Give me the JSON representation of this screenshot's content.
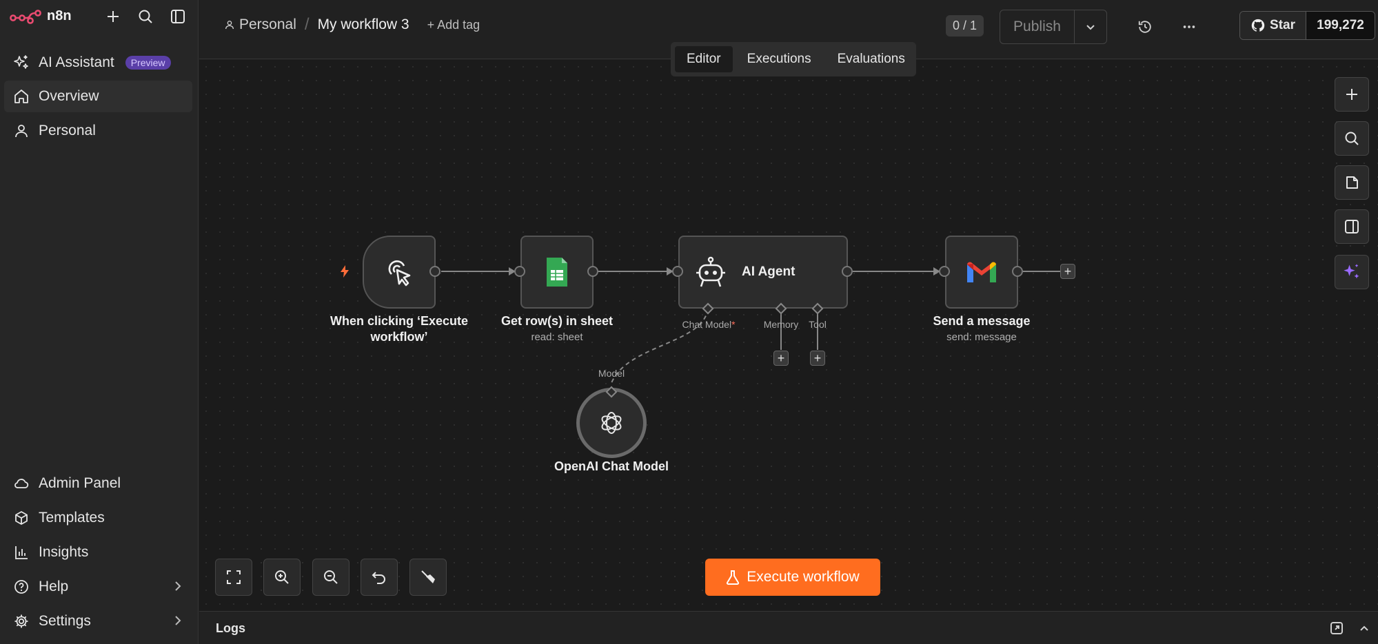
{
  "app": {
    "name": "n8n"
  },
  "sidebar": {
    "top_items": [
      {
        "label": "AI Assistant",
        "badge": "Preview",
        "icon": "sparkles-icon"
      },
      {
        "label": "Overview",
        "icon": "home-icon",
        "active": true
      },
      {
        "label": "Personal",
        "icon": "user-icon"
      }
    ],
    "bottom_items": [
      {
        "label": "Admin Panel",
        "icon": "cloud-icon"
      },
      {
        "label": "Templates",
        "icon": "box-icon"
      },
      {
        "label": "Insights",
        "icon": "bar-chart-icon"
      },
      {
        "label": "Help",
        "icon": "help-icon"
      },
      {
        "label": "Settings",
        "icon": "gear-icon"
      }
    ]
  },
  "header": {
    "project": "Personal",
    "separator": "/",
    "workflow_name": "My workflow 3",
    "add_tag": "+ Add tag",
    "counter": "0 / 1",
    "publish": "Publish",
    "github": {
      "star": "Star",
      "count": "199,272"
    }
  },
  "tabs": [
    {
      "label": "Editor",
      "active": true
    },
    {
      "label": "Executions"
    },
    {
      "label": "Evaluations"
    }
  ],
  "nodes": {
    "trigger": {
      "label_line1": "When clicking ‘Execute",
      "label_line2": "workflow’"
    },
    "sheets": {
      "label": "Get row(s) in sheet",
      "sub": "read: sheet"
    },
    "agent": {
      "label": "AI Agent",
      "inputs": [
        "Chat Model",
        "*",
        "Memory",
        "Tool"
      ]
    },
    "gmail": {
      "label": "Send a message",
      "sub": "send: message"
    },
    "openai": {
      "label": "OpenAI Chat Model",
      "port_label": "Model"
    }
  },
  "execute_button": "Execute workflow",
  "logs": {
    "title": "Logs"
  },
  "colors": {
    "accent": "#ff6d1f",
    "sheets_green": "#34a853",
    "required": "#ff6d5a"
  }
}
